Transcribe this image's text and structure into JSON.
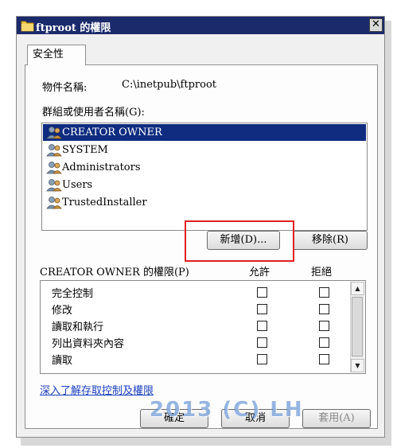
{
  "window": {
    "title": "ftproot 的權限",
    "close_label": "✕"
  },
  "tab": {
    "label": "安全性"
  },
  "object": {
    "label": "物件名稱:",
    "path": "C:\\inetpub\\ftproot"
  },
  "users": {
    "label": "群組或使用者名稱(G):",
    "items": [
      {
        "label": "CREATOR OWNER",
        "selected": true
      },
      {
        "label": "SYSTEM",
        "selected": false
      },
      {
        "label": "Administrators",
        "selected": false
      },
      {
        "label": "Users",
        "selected": false
      },
      {
        "label": "TrustedInstaller",
        "selected": false
      }
    ],
    "add_button": "新增(D)...",
    "remove_button": "移除(R)"
  },
  "permissions": {
    "title": "CREATOR OWNER 的權限(P)",
    "allow_header": "允許",
    "deny_header": "拒絕",
    "rows": [
      {
        "label": "完全控制",
        "allow": false,
        "deny": false
      },
      {
        "label": "修改",
        "allow": false,
        "deny": false
      },
      {
        "label": "讀取和執行",
        "allow": false,
        "deny": false
      },
      {
        "label": "列出資料夾內容",
        "allow": false,
        "deny": false
      },
      {
        "label": "讀取",
        "allow": false,
        "deny": false
      }
    ]
  },
  "link": {
    "label": "深入了解存取控制及權限"
  },
  "footer": {
    "ok": "確定",
    "cancel": "取消",
    "apply": "套用(A)"
  },
  "watermark": "2013 (C) LH",
  "colors": {
    "titlebar": "#1b2a6b",
    "selection": "#0f2c80",
    "highlight_box": "#e02020",
    "link": "#1a3fbf"
  }
}
